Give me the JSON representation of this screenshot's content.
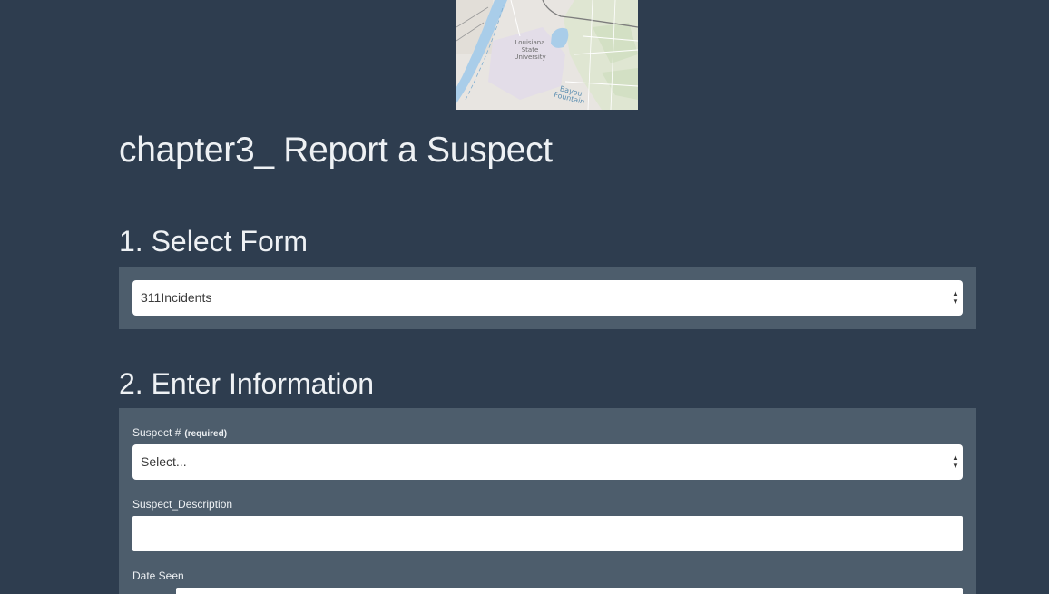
{
  "map": {
    "university_label": "Louisiana State University",
    "bayou_label": "Bayou Fountain"
  },
  "app": {
    "title": "chapter3_ Report a Suspect"
  },
  "step1": {
    "title": "1. Select Form",
    "form_select": {
      "selected": "311Incidents"
    }
  },
  "step2": {
    "title": "2. Enter Information",
    "fields": {
      "suspect_number": {
        "label": "Suspect #",
        "required_note": "(required)",
        "selected": "Select..."
      },
      "suspect_description": {
        "label": "Suspect_Description",
        "value": ""
      },
      "date_seen": {
        "label": "Date Seen"
      }
    }
  },
  "colors": {
    "page_background": "#2e3d4f",
    "panel_background": "#4d5d6c",
    "text": "#eef1f4"
  }
}
